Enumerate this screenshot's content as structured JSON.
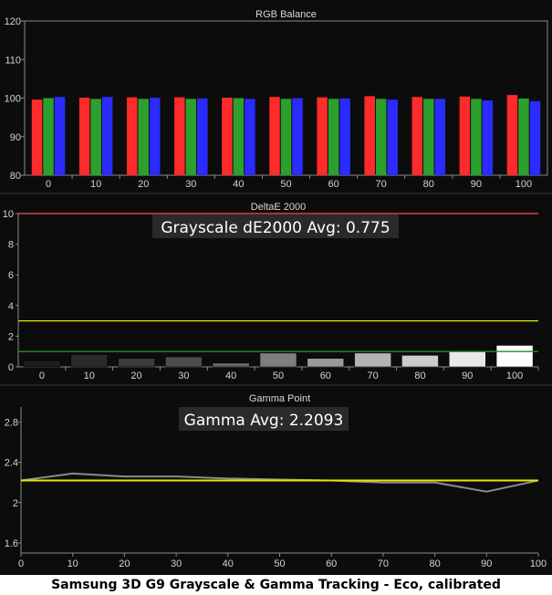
{
  "caption": "Samsung 3D G9 Grayscale & Gamma Tracking - Eco, calibrated",
  "colors": {
    "background": "#0c0c0c",
    "axis": "#8a8a8a",
    "red": "#ff2a2a",
    "green": "#2ca02c",
    "blue": "#2b2bff",
    "limit_red": "#ff4d4d",
    "limit_yellow": "#e6e600",
    "limit_green": "#1f8f1f",
    "gamma_measured": "#8a8a8a",
    "gamma_target": "#e6e600"
  },
  "chart_data": [
    {
      "type": "bar",
      "title": "RGB Balance",
      "categories": [
        "0",
        "10",
        "20",
        "30",
        "40",
        "50",
        "60",
        "70",
        "80",
        "90",
        "100"
      ],
      "ylim": [
        80,
        120
      ],
      "yticks": [
        80,
        90,
        100,
        110,
        120
      ],
      "grid": false,
      "series": [
        {
          "color": "#ff2a2a",
          "values": [
            99.6,
            100.1,
            100.2,
            100.2,
            100.1,
            100.3,
            100.2,
            100.5,
            100.3,
            100.4,
            100.8
          ]
        },
        {
          "color": "#2ca02c",
          "values": [
            100.0,
            99.8,
            99.8,
            99.8,
            100.0,
            99.8,
            99.8,
            99.8,
            99.8,
            99.8,
            99.9
          ]
        },
        {
          "color": "#2b2bff",
          "values": [
            100.3,
            100.3,
            100.1,
            99.9,
            99.8,
            100.0,
            99.9,
            99.6,
            99.8,
            99.4,
            99.2
          ]
        }
      ]
    },
    {
      "type": "bar",
      "title": "DeltaE 2000",
      "annotation": "Grayscale dE2000 Avg: 0.775",
      "categories": [
        "0",
        "10",
        "20",
        "30",
        "40",
        "50",
        "60",
        "70",
        "80",
        "90",
        "100"
      ],
      "values": [
        0.4,
        0.8,
        0.55,
        0.65,
        0.25,
        0.9,
        0.55,
        0.9,
        0.75,
        1.05,
        1.4
      ],
      "bar_colors": [
        "#1e1e1e",
        "#2a2a2a",
        "#3b3b3b",
        "#4d4d4d",
        "#666666",
        "#7f7f7f",
        "#999999",
        "#b3b3b3",
        "#cccccc",
        "#e8e8e8",
        "#ffffff"
      ],
      "ylim": [
        0,
        10
      ],
      "yticks": [
        0,
        2,
        4,
        6,
        8,
        10
      ],
      "reference_lines": [
        {
          "value": 10,
          "color": "#ff4d4d"
        },
        {
          "value": 3,
          "color": "#e6e600"
        },
        {
          "value": 1,
          "color": "#1f8f1f"
        }
      ],
      "grid": false
    },
    {
      "type": "line",
      "title": "Gamma Point",
      "annotation": "Gamma Avg: 2.2093",
      "x": [
        0,
        10,
        20,
        30,
        40,
        50,
        60,
        70,
        80,
        90,
        100
      ],
      "xticks": [
        "0",
        "10",
        "20",
        "30",
        "40",
        "50",
        "60",
        "70",
        "80",
        "90",
        "100"
      ],
      "xlim": [
        0,
        100
      ],
      "ylim": [
        1.5,
        2.95
      ],
      "yticks": [
        1.6,
        2.0,
        2.4,
        2.8
      ],
      "ytick_labels": [
        "1.6",
        "2",
        "2.4",
        "2.8"
      ],
      "series": [
        {
          "color": "#8a8a8a",
          "values": [
            2.22,
            2.29,
            2.26,
            2.26,
            2.24,
            2.23,
            2.22,
            2.2,
            2.2,
            2.11,
            2.22
          ]
        },
        {
          "color": "#e6e600",
          "values": [
            2.22,
            2.22,
            2.22,
            2.22,
            2.22,
            2.22,
            2.22,
            2.22,
            2.22,
            2.22,
            2.22
          ]
        }
      ],
      "grid": false
    }
  ]
}
